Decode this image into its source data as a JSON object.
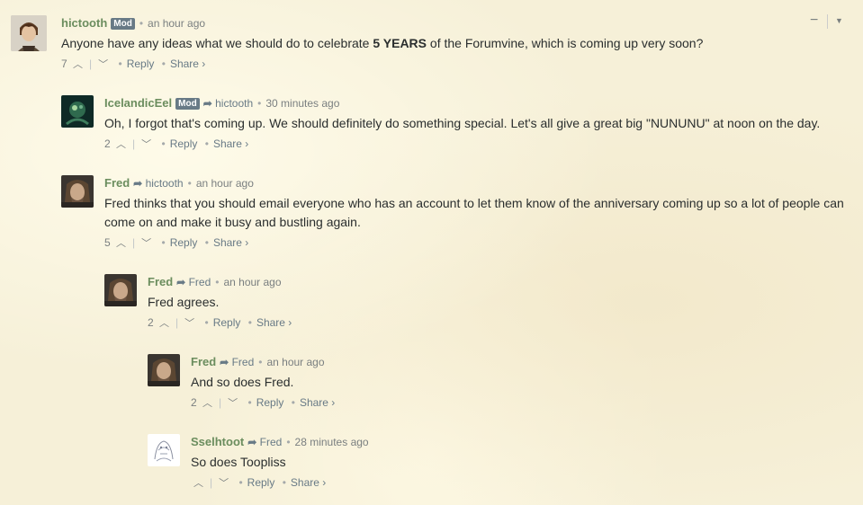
{
  "comments": [
    {
      "author": "hictooth",
      "badge": "Mod",
      "reply_to": "",
      "time": "an hour ago",
      "text_pre": "Anyone have any ideas what we should do to celebrate ",
      "text_bold": "5 YEARS",
      "text_post": " of the Forumvine, which is coming up very soon?",
      "votes": "7",
      "reply": "Reply",
      "share": "Share ›"
    },
    {
      "author": "IcelandicEel",
      "badge": "Mod",
      "reply_to": "hictooth",
      "time": "30 minutes ago",
      "text": "Oh, I forgot that's coming up. We should definitely do something special. Let's all give a great big \"NUNUNU\" at noon on the day.",
      "votes": "2",
      "reply": "Reply",
      "share": "Share ›"
    },
    {
      "author": "Fred",
      "badge": "",
      "reply_to": "hictooth",
      "time": "an hour ago",
      "text": "Fred thinks that you should email everyone who has an account to let them know of the anniversary coming up so a lot of people can come on and make it busy and bustling again.",
      "votes": "5",
      "reply": "Reply",
      "share": "Share ›"
    },
    {
      "author": "Fred",
      "badge": "",
      "reply_to": "Fred",
      "time": "an hour ago",
      "text": "Fred agrees.",
      "votes": "2",
      "reply": "Reply",
      "share": "Share ›"
    },
    {
      "author": "Fred",
      "badge": "",
      "reply_to": "Fred",
      "time": "an hour ago",
      "text": "And so does Fred.",
      "votes": "2",
      "reply": "Reply",
      "share": "Share ›"
    },
    {
      "author": "Sselhtoot",
      "badge": "",
      "reply_to": "Fred",
      "time": "28 minutes ago",
      "text": "So does Toopliss",
      "votes": "",
      "reply": "Reply",
      "share": "Share ›"
    }
  ],
  "icons": {
    "upvote": "chevron-up-icon",
    "downvote": "chevron-down-icon",
    "reply_arrow": "reply-arrow-icon",
    "minimize": "minimize-icon",
    "menu": "caret-down-icon"
  },
  "colors": {
    "author": "#6b8d5e",
    "badge": "#687a86",
    "background": "#f6f0d8"
  }
}
